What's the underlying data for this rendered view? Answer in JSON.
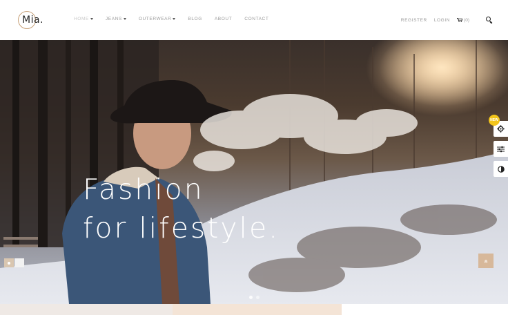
{
  "header": {
    "logo": "Mia.",
    "nav": [
      {
        "label": "HOME",
        "dropdown": true,
        "active": true
      },
      {
        "label": "JEANS",
        "dropdown": true,
        "active": false
      },
      {
        "label": "OUTERWEAR",
        "dropdown": true,
        "active": false
      },
      {
        "label": "BLOG",
        "dropdown": false,
        "active": false
      },
      {
        "label": "ABOUT",
        "dropdown": false,
        "active": false
      },
      {
        "label": "CONTACT",
        "dropdown": false,
        "active": false
      }
    ],
    "register_label": "REGISTER",
    "login_label": "LOGIN",
    "cart_count": "(0)"
  },
  "hero": {
    "title_line1": "Fashion",
    "title_line2": "for lifestyle.",
    "slides": 2,
    "active_slide": 1
  },
  "side_panel": {
    "badge": "NEW",
    "icons": [
      "gear-icon",
      "sliders-icon",
      "contrast-icon"
    ]
  },
  "colors": {
    "accent": "#d7b89a",
    "badge": "#f3c51a"
  }
}
